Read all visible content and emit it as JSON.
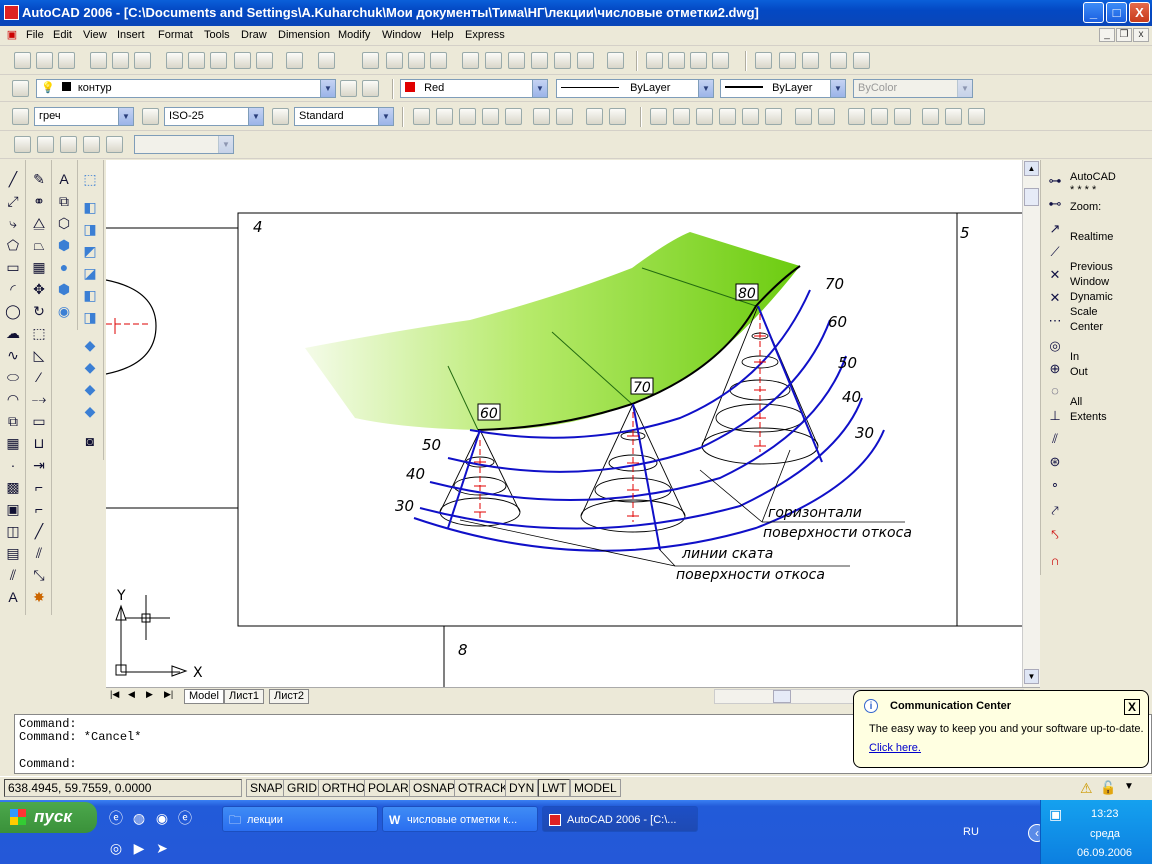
{
  "window": {
    "title": "AutoCAD 2006 - [C:\\Documents and Settings\\A.Kuharchuk\\Мои документы\\Тима\\НГ\\лекции\\числовые отметки2.dwg]",
    "minimize": "_",
    "maximize": "□",
    "close": "X"
  },
  "menu": [
    "File",
    "Edit",
    "View",
    "Insert",
    "Format",
    "Tools",
    "Draw",
    "Dimension",
    "Modify",
    "Window",
    "Help",
    "Express"
  ],
  "layers": {
    "current_layer": "контур",
    "color": "Red",
    "linetype": "ByLayer",
    "lineweight": "ByLayer",
    "plotstyle": "ByColor"
  },
  "styles": {
    "text_style": "греч",
    "dim_style": "ISO-25",
    "table_style": "Standard"
  },
  "drawing": {
    "frame_numbers": [
      "4",
      "5",
      "8"
    ],
    "slope_labels_top": [
      "70",
      "60",
      "50",
      "40",
      "30"
    ],
    "slope_labels_left": [
      "50",
      "40",
      "30"
    ],
    "peak_marks": [
      "80",
      "70",
      "60"
    ],
    "annotation_1a": "горизонтали",
    "annotation_1b": "поверхности откоса",
    "annotation_2a": "линии ската",
    "annotation_2b": "поверхности откоса",
    "ucs_x": "X",
    "ucs_y": "Y"
  },
  "tabs": [
    "Model",
    "Лист1",
    "Лист2"
  ],
  "command_lines": [
    "Command:",
    "Command: *Cancel*",
    "Command:"
  ],
  "status": {
    "coords": "638.4945, 59.7559, 0.0000",
    "buttons": [
      "SNAP",
      "GRID",
      "ORTHO",
      "POLAR",
      "OSNAP",
      "OTRACK",
      "DYN",
      "LWT",
      "MODEL"
    ]
  },
  "right_panel": {
    "header": [
      "AutoCAD",
      "* * * *",
      "Zoom:"
    ],
    "items": [
      "Realtime",
      "Previous",
      "Window",
      "Dynamic",
      "Scale",
      "Center",
      "In",
      "Out",
      "All",
      "Extents"
    ]
  },
  "balloon": {
    "title": "Communication Center",
    "text": "The easy way to keep you and your software up-to-date.",
    "link": "Click here."
  },
  "taskbar": {
    "start": "пуск",
    "tasks": [
      "лекции",
      "числовые отметки к...",
      "AutoCAD 2006 - [C:\\..."
    ],
    "lang": "RU",
    "time": "13:23",
    "day": "среда",
    "date": "06.09.2006"
  },
  "colors": {
    "slope_lines": "#1010c8",
    "red_marks": "#e00000",
    "green_fill": "#7ed321"
  }
}
